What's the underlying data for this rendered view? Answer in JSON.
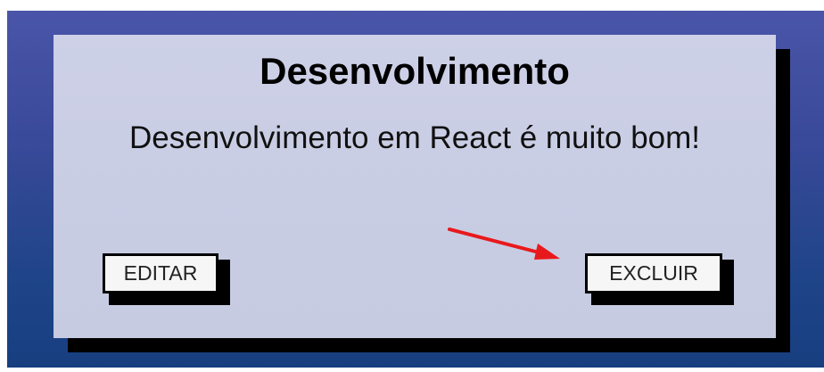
{
  "card": {
    "title": "Desenvolvimento",
    "text": "Desenvolvimento em React é muito bom!"
  },
  "buttons": {
    "edit_label": "EDITAR",
    "delete_label": "EXCLUIR"
  },
  "annotation": {
    "arrow_color": "#e8191c",
    "points_to": "delete-button"
  },
  "colors": {
    "background_top": "#4a55a8",
    "background_bottom": "#173f80",
    "card_background": "#cdd0e6",
    "shadow": "#000000",
    "button_background": "#f6f6f6"
  }
}
